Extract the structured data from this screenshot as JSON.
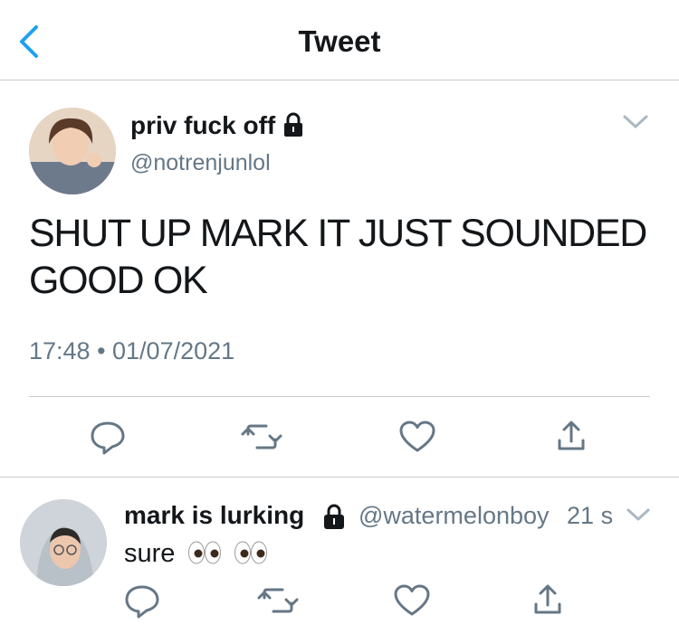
{
  "header": {
    "title": "Tweet"
  },
  "main_tweet": {
    "display_name": "priv fuck off",
    "handle": "@notrenjunlol",
    "text": "SHUT UP MARK IT JUST SOUNDED GOOD OK",
    "timestamp": "17:48 • 01/07/2021"
  },
  "reply": {
    "display_name": "mark is lurking",
    "handle": "@watermelonboy",
    "time": "21 s",
    "text": "sure"
  },
  "icons": [
    "back-chevron",
    "lock",
    "chevron-down",
    "reply",
    "retweet",
    "like",
    "share",
    "eyes"
  ],
  "colors": {
    "accent": "#1da1f2",
    "text": "#14171a",
    "secondary": "#657786",
    "divider": "#c8ccd0"
  }
}
